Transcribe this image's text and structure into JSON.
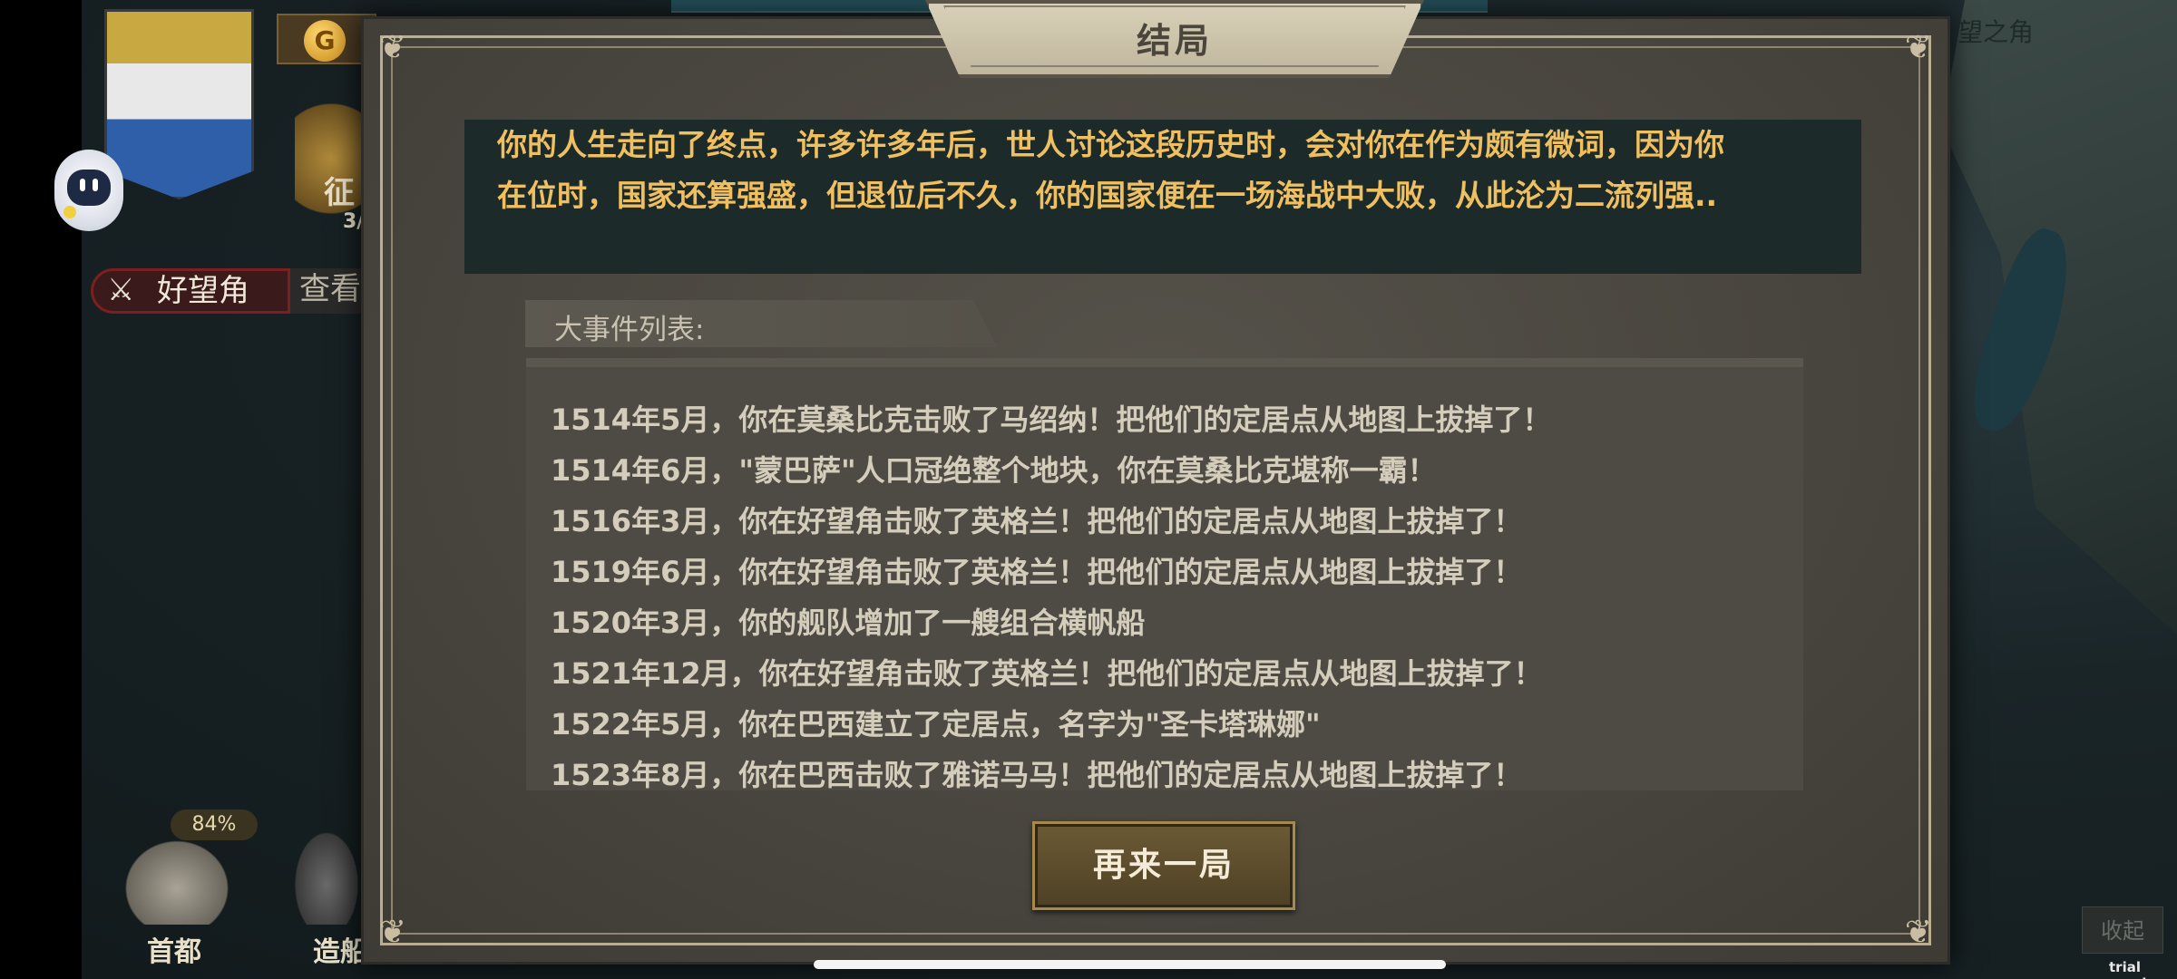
{
  "map": {
    "corner_label": "望之角"
  },
  "hud": {
    "coin_icon_glyph": "G",
    "conquer_partial": "征",
    "conquer_count_partial": "3/",
    "location_name": "好望角",
    "view_label_partial": "查看",
    "capital_progress": "84%",
    "capital_progress_value": 84,
    "capital_label": "首都",
    "shipyard_label_partial": "造船",
    "collapse_label": "收起",
    "icons": [
      "robot-assistant-icon",
      "coin-icon",
      "laurel-icon",
      "crossed-swords-icon",
      "capital-building-icon",
      "ship-icon"
    ]
  },
  "dialog": {
    "title": "结局",
    "summary_line1": "你的人生走向了终点，许多许多年后，世人讨论这段历史时，会对你在作为颇有微词，因为你",
    "summary_line2": "在位时，国家还算强盛，但退位后不久，你的国家便在一场海战中大败，从此沦为二流列强..",
    "events_header": "大事件列表:",
    "events": [
      "1514年5月，你在莫桑比克击败了马绍纳！把他们的定居点从地图上拔掉了！",
      "1514年6月，\"蒙巴萨\"人口冠绝整个地块，你在莫桑比克堪称一霸！",
      "1516年3月，你在好望角击败了英格兰！把他们的定居点从地图上拔掉了！",
      "1519年6月，你在好望角击败了英格兰！把他们的定居点从地图上拔掉了！",
      "1520年3月，你的舰队增加了一艘组合横帆船",
      "1521年12月，你在好望角击败了英格兰！把他们的定居点从地图上拔掉了！",
      "1522年5月，你在巴西建立了定居点，名字为\"圣卡塔琳娜\"",
      "1523年8月，你在巴西击败了雅诺马马！把他们的定居点从地图上拔掉了！"
    ],
    "replay_button": "再来一局"
  },
  "footer": {
    "trial_label": "trial version"
  },
  "colors": {
    "summary_text": "#f0c060",
    "summary_bg": "#1d2a2a",
    "dialog_bg": "#4a4740",
    "event_text": "#d4cdbc",
    "button_bg": "#5c4c2c"
  }
}
